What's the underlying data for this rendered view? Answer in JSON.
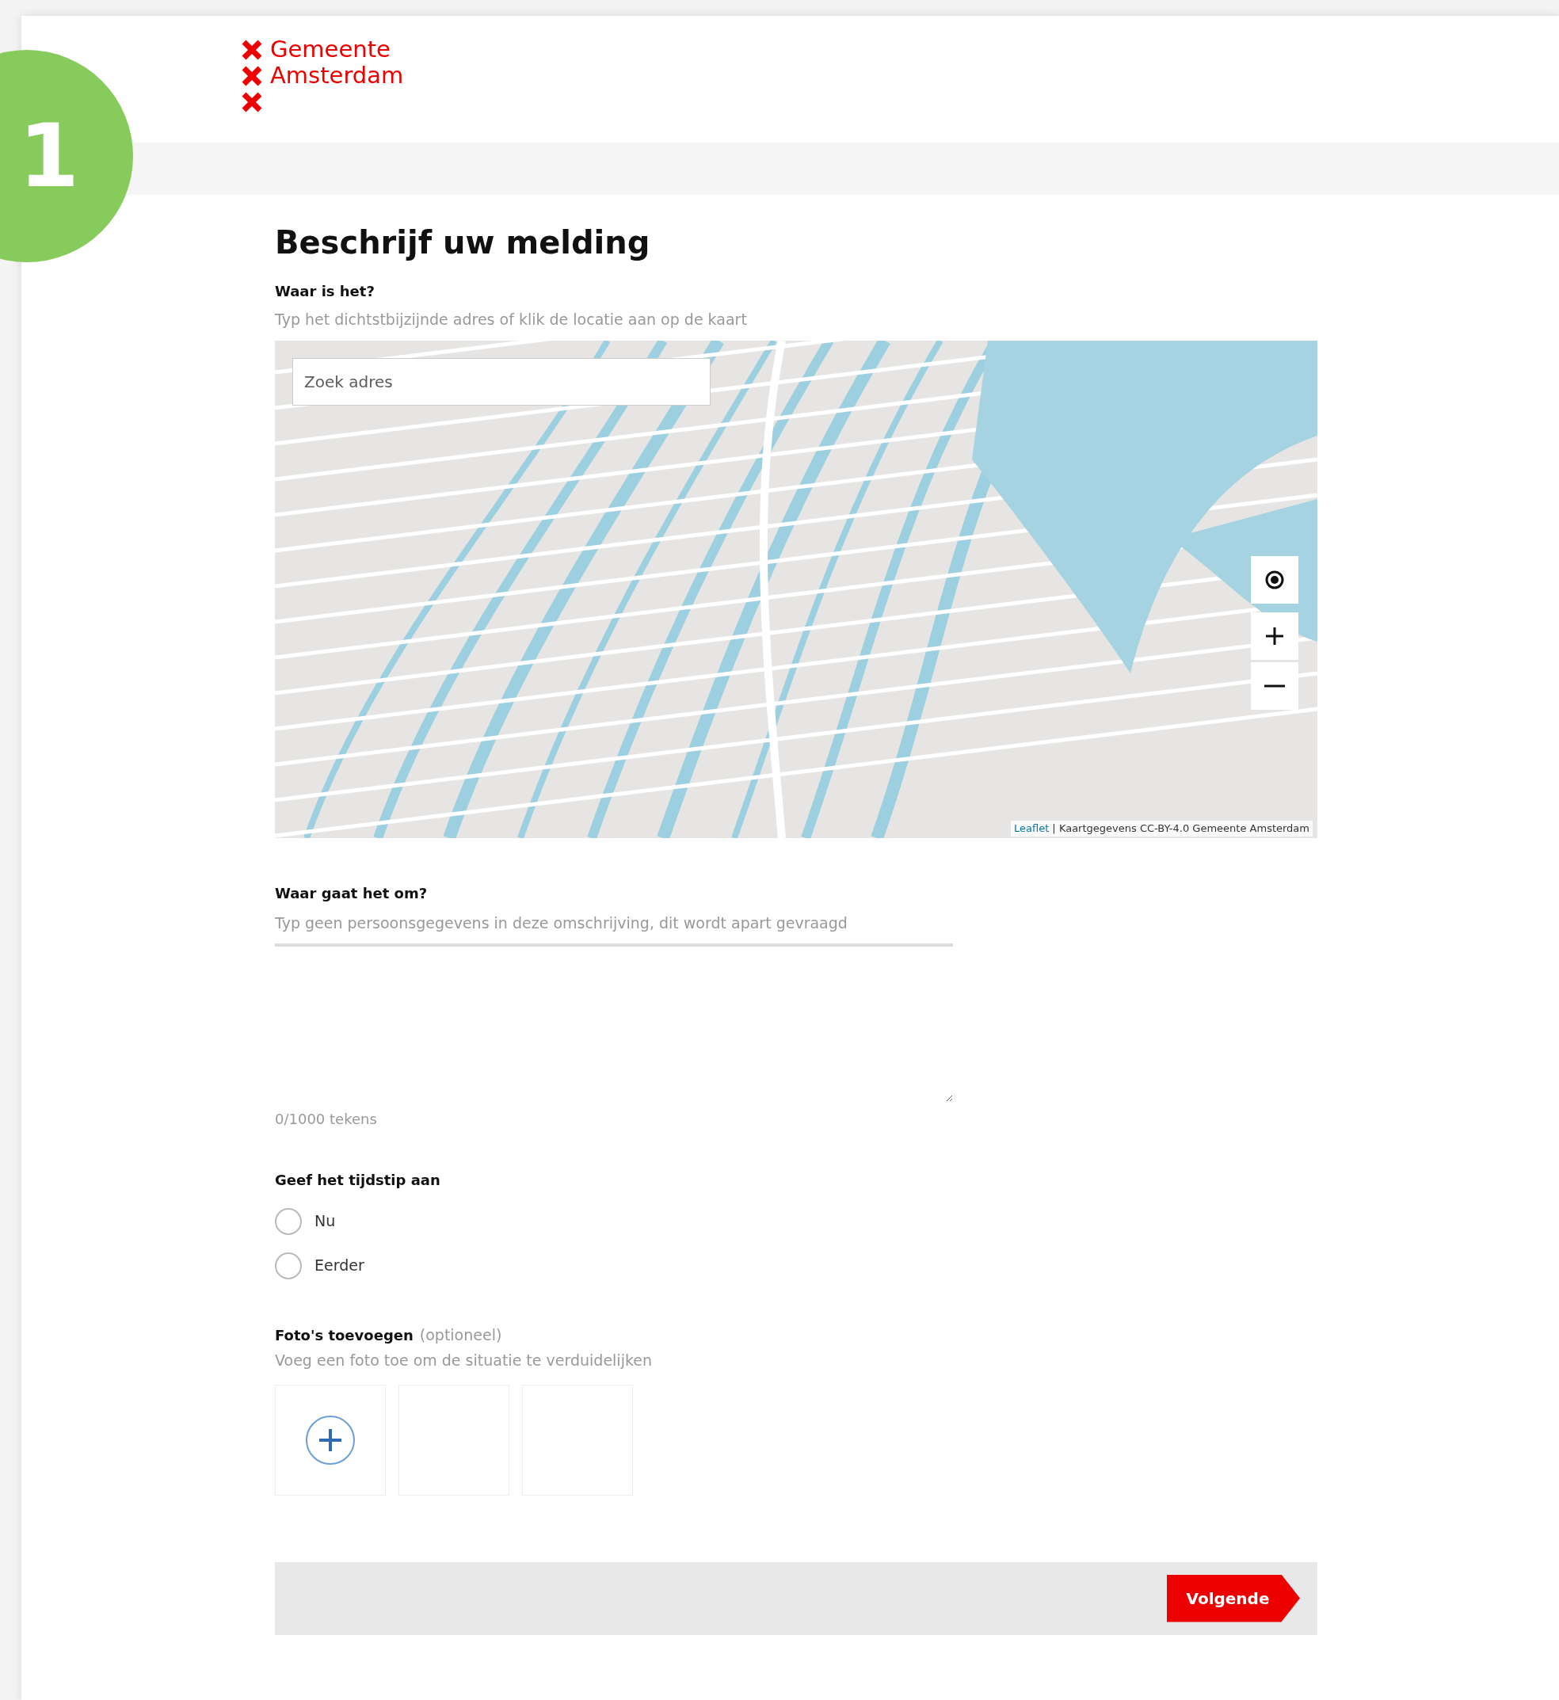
{
  "step_badge": "1",
  "logo": {
    "lines": [
      "Gemeente",
      "Amsterdam"
    ]
  },
  "title": "Beschrijf uw melding",
  "location": {
    "label": "Waar is het?",
    "hint": "Typ het dichtstbijzijnde adres of klik de locatie aan op de kaart",
    "search": {
      "placeholder": "Zoek adres"
    },
    "attribution": {
      "link": "Leaflet",
      "text": "| Kaartgegevens CC-BY-4.0 Gemeente Amsterdam"
    }
  },
  "description": {
    "label": "Waar gaat het om?",
    "placeholder": "Typ geen persoonsgegevens in deze omschrijving, dit wordt apart gevraagd",
    "counter": "0/1000 tekens"
  },
  "time": {
    "label": "Geef het tijdstip aan",
    "options": [
      {
        "label": "Nu",
        "selected": false
      },
      {
        "label": "Eerder",
        "selected": false
      }
    ]
  },
  "photos": {
    "label": "Foto's toevoegen",
    "optional": "(optioneel)",
    "hint": "Voeg een foto toe om de situatie te verduidelijken",
    "slots": [
      {
        "kind": "add"
      },
      {
        "kind": "empty"
      },
      {
        "kind": "empty"
      }
    ]
  },
  "next_button": "Volgende"
}
